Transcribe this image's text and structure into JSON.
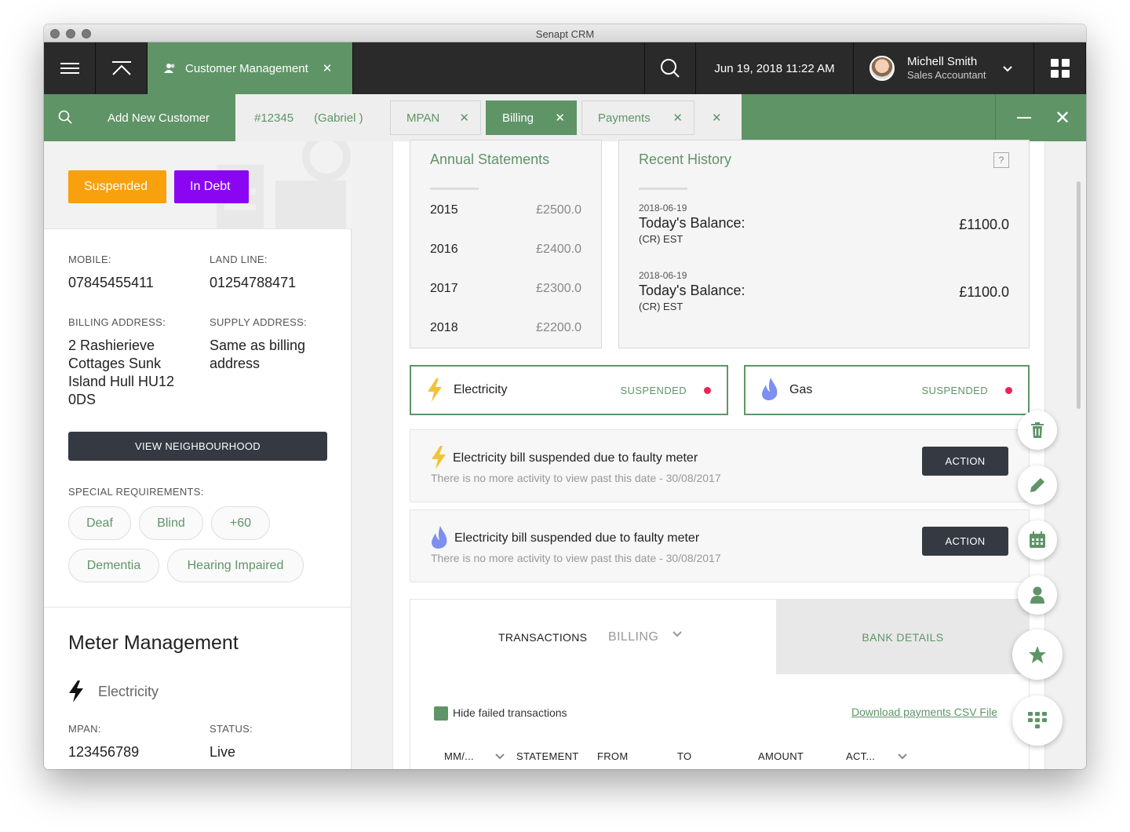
{
  "window": {
    "title": "Senapt CRM"
  },
  "topbar": {
    "module_tab": "Customer Management",
    "datetime": "Jun 19, 2018 11:22 AM",
    "user_name": "Michell Smith",
    "user_role": "Sales Accountant"
  },
  "subbar": {
    "add_new": "Add New Customer",
    "customer_id": "#12345",
    "customer_name": "(Gabriel )",
    "tabs": [
      "MPAN",
      "Billing",
      "Payments"
    ]
  },
  "customer": {
    "badges": [
      "Suspended",
      "In Debt"
    ],
    "mobile_label": "MOBILE:",
    "mobile": "07845455411",
    "landline_label": "LAND LINE:",
    "landline": "01254788471",
    "billing_label": "BILLING ADDRESS:",
    "billing_address": "2 Rashierieve Cottages Sunk Island Hull HU12 0DS",
    "supply_label": "SUPPLY ADDRESS:",
    "supply_address": "Same as billing address",
    "view_neighbourhood": "VIEW NEIGHBOURHOOD",
    "special_label": "SPECIAL REQUIREMENTS:",
    "special": [
      "Deaf",
      "Blind",
      "+60",
      "Dementia",
      "Hearing Impaired"
    ]
  },
  "meter": {
    "title": "Meter Management",
    "type": "Electricity",
    "mpan_label": "MPAN:",
    "mpan": "123456789",
    "status_label": "STATUS:",
    "status": "Live"
  },
  "annual": {
    "title": "Annual Statements",
    "rows": [
      {
        "year": "2015",
        "amount": "£2500.0"
      },
      {
        "year": "2016",
        "amount": "£2400.0"
      },
      {
        "year": "2017",
        "amount": "£2300.0"
      },
      {
        "year": "2018",
        "amount": "£2200.0"
      }
    ]
  },
  "recent": {
    "title": "Recent History",
    "help": "?",
    "items": [
      {
        "date": "2018-06-19",
        "title": "Today's Balance:",
        "sub": "(CR) EST",
        "amount": "£1100.0"
      },
      {
        "date": "2018-06-19",
        "title": "Today's Balance:",
        "sub": "(CR) EST",
        "amount": "£1100.0"
      }
    ]
  },
  "utilities": [
    {
      "name": "Electricity",
      "status": "SUSPENDED",
      "status_color": "#ee2255"
    },
    {
      "name": "Gas",
      "status": "SUSPENDED",
      "status_color": "#ee2255"
    }
  ],
  "activities": [
    {
      "title": "Electricity bill suspended due to faulty meter",
      "sub": "There is no more activity to view past this date - 30/08/2017",
      "action": "ACTION"
    },
    {
      "title": "Electricity bill suspended due to faulty meter",
      "sub": "There is no more activity to view past this date - 30/08/2017",
      "action": "ACTION"
    }
  ],
  "transactions": {
    "tab_transactions": "TRANSACTIONS",
    "tab_billing": "BILLING",
    "tab_bank": "BANK DETAILS",
    "hide_failed": "Hide failed transactions",
    "csv_link": "Download payments CSV File",
    "columns": [
      "MM/...",
      "STATEMENT",
      "FROM",
      "TO",
      "AMOUNT",
      "ACT..."
    ]
  },
  "fab_icons": [
    "trash-icon",
    "pencil-icon",
    "calendar-icon",
    "person-icon",
    "star-icon",
    "dialpad-icon"
  ],
  "colors": {
    "accent": "#5f9467",
    "dark": "#2a2a2a",
    "suspended": "#f8a10c",
    "in_debt": "#8a06f2",
    "button": "#353a42"
  }
}
